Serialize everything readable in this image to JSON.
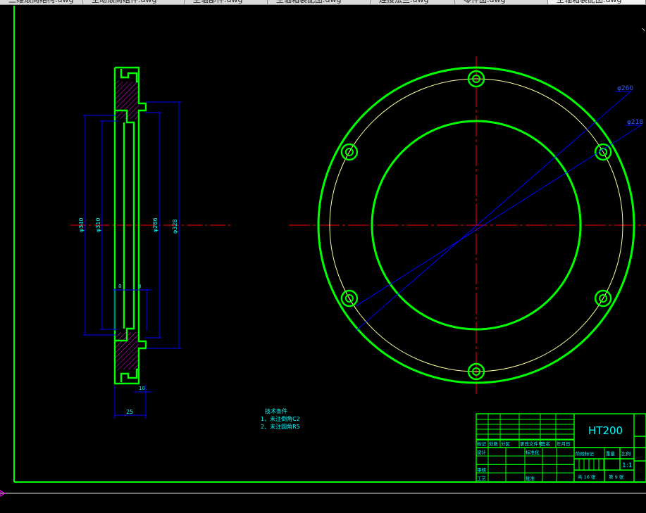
{
  "tabs": [
    {
      "label": "三维滚筒结构.dwg"
    },
    {
      "label": "主动滚筒组件.dwg"
    },
    {
      "label": "主轴部件.dwg"
    },
    {
      "label": "主轴箱装配图.dwg"
    },
    {
      "label": "连接法兰.dwg"
    },
    {
      "label": "零件图.dwg"
    },
    {
      "label": "主轴箱装配图.dwg"
    }
  ],
  "active_tab": 6,
  "colors": {
    "background": "#000000",
    "part_outline": "#00ff00",
    "dimension": "#0000ff",
    "centerline": "#ff0000",
    "hatch": "#ff00ff",
    "text": "#00ffff",
    "bolt_circle": "#ffff99",
    "border": "#00ff00"
  },
  "drawing": {
    "section_dims": {
      "d1": "φ340",
      "d2": "φ310",
      "d3": "φ286",
      "d4": "φ328",
      "small1": "8",
      "small2": "8",
      "bottom_small": "10",
      "width": "25"
    },
    "front_view": {
      "dia_outer": "φ260",
      "dia_inner": "φ218"
    },
    "notes": {
      "title": "技术条件",
      "line1": "1、未注倒角C2",
      "line2": "2、未注圆角R5"
    },
    "title_block": {
      "material": "HT200",
      "headers": [
        "标记",
        "处数",
        "分区",
        "更改文件号",
        "签名",
        "年月日"
      ],
      "design": "设计",
      "standardize": "标准化",
      "review": "审核",
      "craft": "工艺",
      "approve": "批准",
      "stage": "阶段标记",
      "weight": "重量",
      "scale": "比例",
      "scale_value": "1:1",
      "total_sheets": "共 16 张",
      "sheet_no": "第 9 张"
    }
  }
}
